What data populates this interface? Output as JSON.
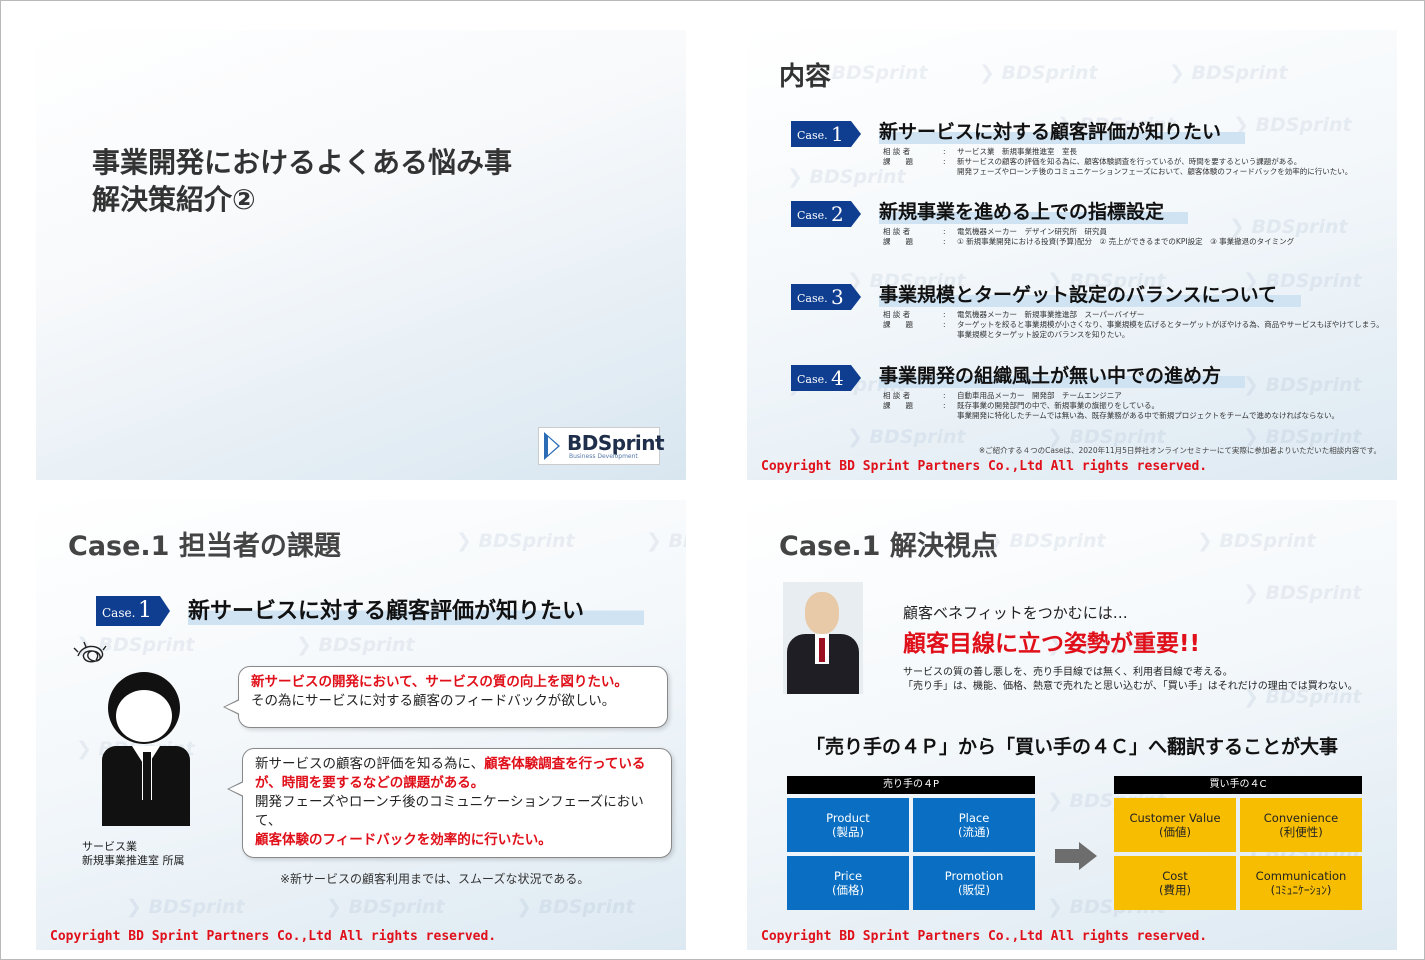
{
  "slide1": {
    "title_line1": "事業開発におけるよくある悩み事",
    "title_line2": "解決策紹介②",
    "logo_text": "BDSprint",
    "logo_sub": "Business Development"
  },
  "slide2": {
    "heading": "内容",
    "case_prefix": "Case.",
    "cases": [
      {
        "num": "1",
        "title": "新サービスに対する顧客評価が知りたい",
        "rows": [
          {
            "k": "相 談 者",
            "v": "サービス業　新規事業推進室　室長"
          },
          {
            "k": "課　　題",
            "v": "新サービスの顧客の評価を知る為に、顧客体験調査を行っているが、時間を要するという課題がある。"
          },
          {
            "k": "",
            "v": "開発フェーズやローンチ後のコミュニケーションフェーズにおいて、顧客体験のフィードバックを効率的に行いたい。"
          }
        ]
      },
      {
        "num": "2",
        "title": "新規事業を進める上での指標設定",
        "rows": [
          {
            "k": "相 談 者",
            "v": "電気機器メーカー　デザイン研究所　研究員"
          },
          {
            "k": "課　　題",
            "v": "① 新規事業開発における投資(予算)配分　② 売上ができるまでのKPI設定　③ 事業撤退のタイミング"
          }
        ]
      },
      {
        "num": "3",
        "title": "事業規模とターゲット設定のバランスについて",
        "rows": [
          {
            "k": "相 談 者",
            "v": "電気機器メーカー　新規事業推進部　スーパーバイザー"
          },
          {
            "k": "課　　題",
            "v": "ターゲットを絞ると事業規模が小さくなり、事業規模を広げるとターゲットがぼやける為、商品やサービスもぼやけてしまう。"
          },
          {
            "k": "",
            "v": "事業規模とターゲット設定のバランスを知りたい。"
          }
        ]
      },
      {
        "num": "4",
        "title": "事業開発の組織風土が無い中での進め方",
        "rows": [
          {
            "k": "相 談 者",
            "v": "自動車用品メーカー　開発部　チームエンジニア"
          },
          {
            "k": "課　　題",
            "v": "既存事業の開発部門の中で、新規事業の旗振りをしている。"
          },
          {
            "k": "",
            "v": "事業開発に特化したチームでは無い為、既存業務がある中で新規プロジェクトをチームで進めなければならない。"
          }
        ]
      }
    ],
    "note": "※ご紹介する４つのCaseは、2020年11月5日弊社オンラインセミナーにて実際に参加者よりいただいた相談内容です。",
    "copyright": "Copyright BD Sprint Partners Co.,Ltd  All rights reserved."
  },
  "slide3": {
    "heading": "Case.1 担当者の課題",
    "badge_prefix": "Case.",
    "badge_num": "1",
    "case_title": "新サービスに対する顧客評価が知りたい",
    "bubble1_red": "新サービスの開発において、サービスの質の向上を図りたい。",
    "bubble1_normal": "その為にサービスに対する顧客のフィードバックが欲しい。",
    "bubble2_p1": "新サービスの顧客の評価を知る為に、",
    "bubble2_red1": "顧客体験調査を行っているが、時間を要するなどの課題がある。",
    "bubble2_p2": "開発フェーズやローンチ後のコミュニケーションフェーズにおいて、",
    "bubble2_red2": "顧客体験のフィードバックを効率的に行いたい。",
    "person_line1": "サービス業",
    "person_line2": "新規事業推進室 所属",
    "footnote": "※新サービスの顧客利用までは、スムーズな状況である。",
    "copyright": "Copyright BD Sprint Partners Co.,Ltd  All rights reserved."
  },
  "slide4": {
    "heading": "Case.1 解決視点",
    "sub": "顧客ベネフィットをつかむには…",
    "big": "顧客目線に立つ姿勢が重要!!",
    "expl1": "サービスの質の善し悪しを、売り手目線では無く、利用者目線で考える。",
    "expl2": "「売り手」は、機能、価格、熱意で売れたと思い込むが、「買い手」はそれだけの理由では買わない。",
    "headline": "「売り手の４Ｐ」から「買い手の４Ｃ」へ翻訳することが大事",
    "four_p": {
      "header": "売り手の４P",
      "cells": [
        {
          "en": "Product",
          "ja": "(製品)"
        },
        {
          "en": "Place",
          "ja": "(流通)"
        },
        {
          "en": "Price",
          "ja": "(価格)"
        },
        {
          "en": "Promotion",
          "ja": "(販促)"
        }
      ]
    },
    "four_c": {
      "header": "買い手の４C",
      "cells": [
        {
          "en": "Customer Value",
          "ja": "(価値)"
        },
        {
          "en": "Convenience",
          "ja": "(利便性)"
        },
        {
          "en": "Cost",
          "ja": "(費用)"
        },
        {
          "en": "Communication",
          "ja": "(ｺﾐｭﾆｹｰｼｮﾝ)"
        }
      ]
    },
    "colors": {
      "blue": "#0a6fc2",
      "yellow": "#f7bd00",
      "red": "#e0101a",
      "navy": "#0f3d8f"
    },
    "copyright": "Copyright BD Sprint Partners Co.,Ltd  All rights reserved."
  },
  "watermark": "BDSprint"
}
